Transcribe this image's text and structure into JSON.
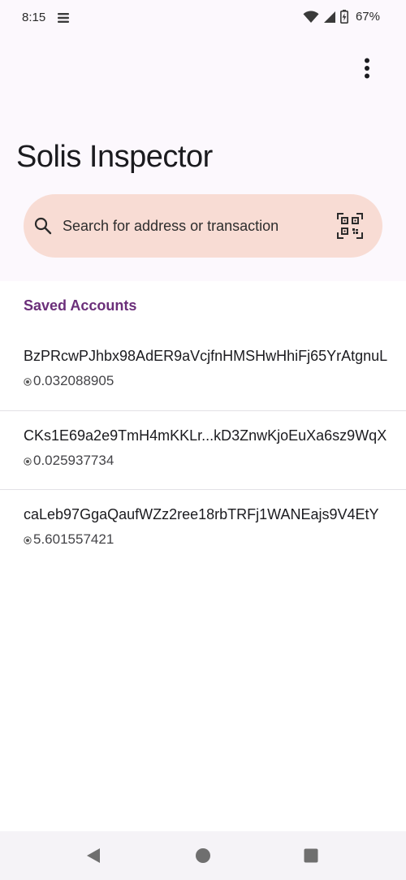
{
  "status_bar": {
    "time": "8:15",
    "battery": "67%"
  },
  "header": {
    "title": "Solis Inspector"
  },
  "search": {
    "placeholder": "Search for address or transaction",
    "value": ""
  },
  "saved_accounts": {
    "title": "Saved Accounts",
    "items": [
      {
        "address": "BzPRcwPJhbx98AdER9aVcjfnHMSHwHhiFj65YrAtgnuL",
        "balance": "0.032088905"
      },
      {
        "address": "CKs1E69a2e9TmH4mKKLr...kD3ZnwKjoEuXa6sz9WqX",
        "balance": "0.025937734"
      },
      {
        "address": "caLeb97GgaQaufWZz2ree18rbTRFj1WANEajs9V4EtY",
        "balance": "5.601557421"
      }
    ]
  },
  "colors": {
    "header_bg": "#fcf8fd",
    "search_bg": "#f8dcd4",
    "accent": "#6b2f7a"
  },
  "icons": {
    "search": "search-icon",
    "qr": "qr-code-scan-icon",
    "overflow": "more-vert-icon",
    "currency": "sol-currency-icon"
  }
}
